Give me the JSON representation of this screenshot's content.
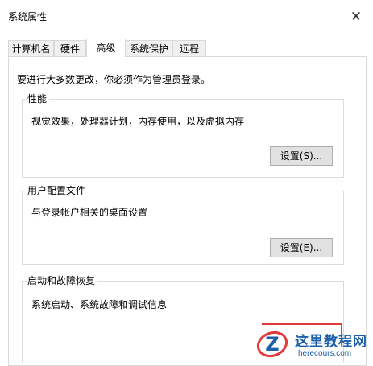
{
  "window": {
    "title": "系统属性",
    "close_glyph": "✕"
  },
  "tabs": [
    {
      "label": "计算机名",
      "active": false
    },
    {
      "label": "硬件",
      "active": false
    },
    {
      "label": "高级",
      "active": true
    },
    {
      "label": "系统保护",
      "active": false
    },
    {
      "label": "远程",
      "active": false
    }
  ],
  "advanced": {
    "notice": "要进行大多数更改，你必须作为管理员登录。",
    "performance": {
      "title": "性能",
      "description": "视觉效果，处理器计划，内存使用，以及虚拟内存",
      "button": "设置(S)..."
    },
    "user_profiles": {
      "title": "用户配置文件",
      "description": "与登录帐户相关的桌面设置",
      "button": "设置(E)..."
    },
    "startup_recovery": {
      "title": "启动和故障恢复",
      "description": "系统启动、系统故障和调试信息"
    }
  },
  "watermark": {
    "logo_letter": "Z",
    "site_name": "这里教程网",
    "url": "herecours.com",
    "colors": {
      "primary": "#1d5fa8",
      "accent": "#e23a3a"
    }
  },
  "colors": {
    "annotation_red": "#e23a3a",
    "button_bg": "#e1e1e1",
    "border": "#d9d9d9"
  }
}
